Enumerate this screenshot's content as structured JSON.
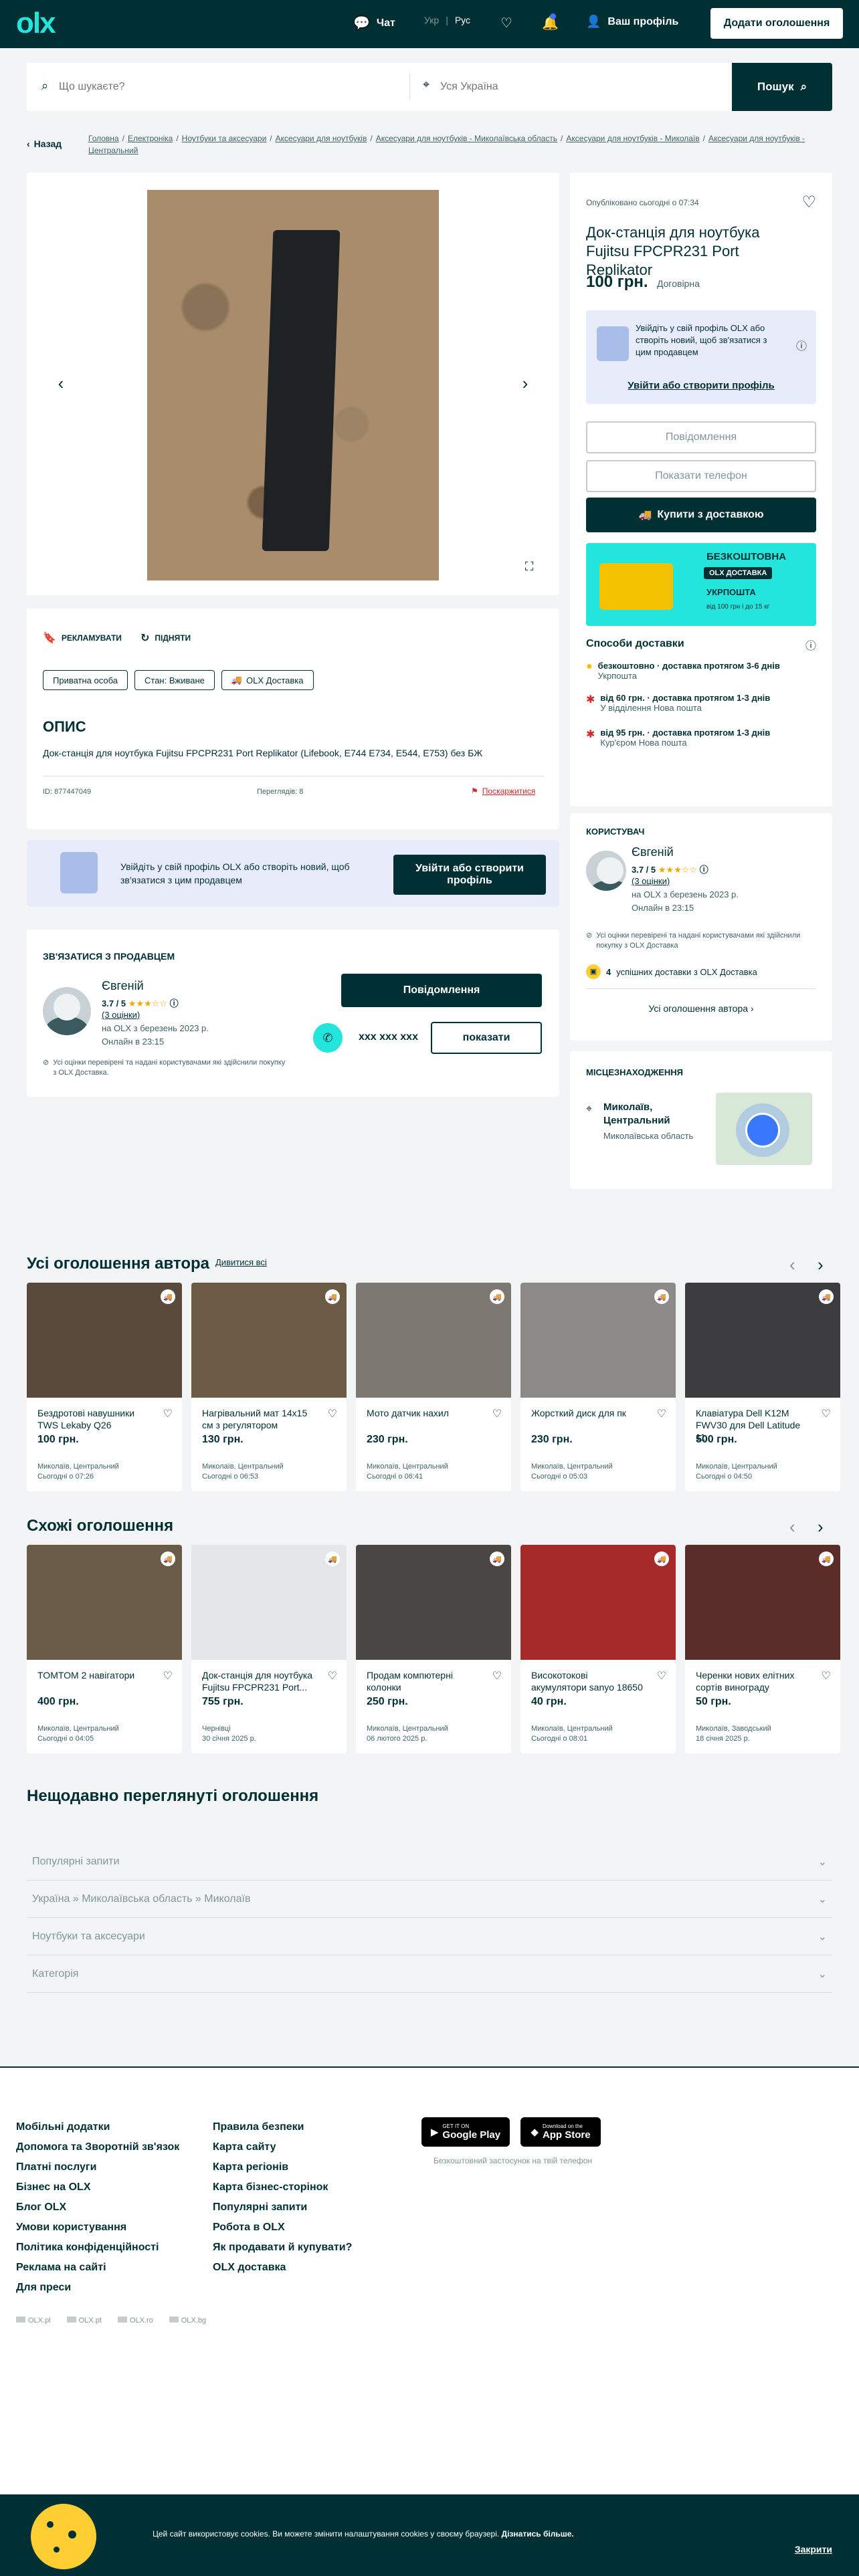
{
  "header": {
    "logo": "olx",
    "chat": "Чат",
    "lang_ukr": "Укр",
    "lang_sep": "|",
    "lang_rus": "Рус",
    "profile": "Ваш профіль",
    "post_ad": "Додати оголошення"
  },
  "search": {
    "query_placeholder": "Що шукаєте?",
    "location_placeholder": "Уся Україна",
    "button": "Пошук"
  },
  "breadcrumbs": {
    "back": "Назад",
    "items": [
      "Головна",
      "Електроніка",
      "Ноутбуки та аксесуари",
      "Аксесуари для ноутбуків",
      "Аксесуари для ноутбуків - Миколаївська область",
      "Аксесуари для ноутбуків - Миколаїв",
      "Аксесуари для ноутбуків - Центральний"
    ],
    "sep": "/"
  },
  "ad": {
    "published": "Опубліковано сьогодні о 07:34",
    "title": "Док-станція для ноутбука Fujitsu FPCPR231 Port Replikator",
    "price": "100 грн.",
    "negotiable": "Договірна",
    "promote": "РЕКЛАМУВАТИ",
    "raise": "ПІДНЯТИ",
    "tags": [
      "Приватна особа",
      "Стан: Вживане",
      "OLX Доставка"
    ],
    "description_heading": "ОПИС",
    "description": "Док-станція для ноутбука Fujitsu FPCPR231 Port Replikator (Lifebook, E744 E734, E544, E753) без БЖ",
    "id": "ID: 877447049",
    "views": "Переглядів: 8",
    "report": "Поскаржитися"
  },
  "side": {
    "login_text": "Увійдіть у свій профіль OLX або створіть новий, щоб зв'язатися з цим продавцем",
    "login_link": "Увійти або створити профіль",
    "message_btn": "Повідомлення",
    "phone_btn": "Показати телефон",
    "buy_btn": "Купити з доставкою",
    "promo_free": "БЕЗКОШТОВНА",
    "promo_olx": "OLX ДОСТАВКА",
    "promo_ukr": "УКРПОШТА",
    "promo_note": "від 100 грн і до 15 кг",
    "delivery_title": "Способи доставки",
    "delivery": [
      {
        "main": "безкоштовно · доставка протягом 3-6 днів",
        "sub": "Укрпошта"
      },
      {
        "main": "від 60 грн. · доставка протягом 1-3 днів",
        "sub": "У відділення Нова пошта"
      },
      {
        "main": "від 95 грн. · доставка протягом 1-3 днів",
        "sub": "Кур'єром Нова пошта"
      }
    ]
  },
  "user": {
    "heading": "КОРИСТУВАЧ",
    "name": "Євгеній",
    "rating": "3.7 / 5",
    "stars": "★★★☆☆",
    "reviews": "(3 оцінки)",
    "since": "на OLX з березень 2023 р.",
    "online": "Онлайн в 23:15",
    "note": "Усі оцінки перевірені та надані користувачами які здійснили покупку з OLX Доставка",
    "deliveries_count": "4",
    "deliveries": "успішних доставки з OLX Доставка",
    "all_ads": "Усі оголошення автора"
  },
  "location": {
    "heading": "МІСЦЕЗНАХОДЖЕННЯ",
    "city": "Миколаїв, Центральний",
    "region": "Миколаївська область"
  },
  "login_banner": {
    "text": "Увійдіть у свій профіль OLX або створіть новий, щоб зв'язатися з цим продавцем",
    "button": "Увійти або створити профіль"
  },
  "contact": {
    "heading": "ЗВ'ЯЗАТИСЯ З ПРОДАВЦЕМ",
    "name": "Євгеній",
    "rating": "3.7 / 5",
    "stars": "★★★☆☆",
    "reviews": "(3 оцінки)",
    "since": "на OLX з березень 2023 р.",
    "online": "Онлайн в 23:15",
    "note": "Усі оцінки перевірені та надані користувачами які здійснили покупку з OLX Доставка.",
    "message_btn": "Повідомлення",
    "phone_masked": "xxx xxx xxx",
    "show_btn": "показати"
  },
  "author_ads": {
    "heading": "Усі оголошення автора",
    "see_all": "Дивитися всі",
    "items": [
      {
        "title": "Бездротові навушники TWS Lekaby Q26",
        "price": "100 грн.",
        "loc": "Миколаїв, Центральний",
        "date": "Сьогодні о 07:26",
        "color": "#5a4a3c"
      },
      {
        "title": "Нагрівальний мат 14х15 см з регулятором",
        "price": "130 грн.",
        "loc": "Миколаїв, Центральний",
        "date": "Сьогодні о 06:53",
        "color": "#6b5a44"
      },
      {
        "title": "Мото датчик нахил",
        "price": "230 грн.",
        "loc": "Миколаїв, Центральний",
        "date": "Сьогодні о 06:41",
        "color": "#7d7872"
      },
      {
        "title": "Жорсткий диск для пк",
        "price": "230 грн.",
        "loc": "Миколаїв, Центральний",
        "date": "Сьогодні о 05:03",
        "color": "#8c8a86"
      },
      {
        "title": "Клавіатура Dell K12M FWV30 для Dell Latitude 11...",
        "price": "500 грн.",
        "loc": "Миколаїв, Центральний",
        "date": "Сьогодні о 04:50",
        "color": "#3c3c3e"
      }
    ]
  },
  "similar": {
    "heading": "Схожі оголошення",
    "items": [
      {
        "title": "TOMTOM 2 навігатори",
        "price": "400 грн.",
        "loc": "Миколаїв, Центральний",
        "date": "Сьогодні о 04:05",
        "color": "#6a5a48"
      },
      {
        "title": "Док-станція для ноутбука Fujitsu FPCPR231 Port...",
        "price": "755 грн.",
        "loc": "Чернівці",
        "date": "30 січня 2025 р.",
        "color": "#e4e6e8"
      },
      {
        "title": "Продам компютерні колонки",
        "price": "250 грн.",
        "loc": "Миколаїв, Центральний",
        "date": "06 лютого 2025 р.",
        "color": "#4a4644"
      },
      {
        "title": "Високотокові акумулятори sanyo 18650",
        "price": "40 грн.",
        "loc": "Миколаїв, Центральний",
        "date": "Сьогодні о 08:01",
        "color": "#a62a2a"
      },
      {
        "title": "Черенки нових елітних сортів винограду",
        "price": "50 грн.",
        "loc": "Миколаїв, Заводський",
        "date": "18 січня 2025 р.",
        "color": "#5a2c2a"
      }
    ]
  },
  "recent": {
    "heading": "Нещодавно переглянуті оголошення"
  },
  "accordion": [
    "Популярні запити",
    "Україна » Миколаївська область » Миколаїв",
    "Ноутбуки та аксесуари",
    "Категорія"
  ],
  "footer": {
    "col1": [
      "Мобільні додатки",
      "Допомога та Зворотній зв'язок",
      "Платні послуги",
      "Бізнес на OLX",
      "Блог OLX",
      "Умови користування",
      "Політика конфіденційності",
      "Реклама на сайті",
      "Для преси"
    ],
    "col2": [
      "Правила безпеки",
      "Карта сайту",
      "Карта регіонів",
      "Карта бізнес-сторінок",
      "Популярні запити",
      "Робота в OLX",
      "Як продавати й купувати?",
      "OLX доставка"
    ],
    "google": "Google Play",
    "google_small": "GET IT ON",
    "apple": "App Store",
    "apple_small": "Download on the",
    "app_note": "Безкоштовний застосунок на твій телефон",
    "sites": [
      "OLX.pl",
      "OLX.pt",
      "OLX.ro",
      "OLX.bg"
    ]
  },
  "cookie": {
    "text": "Цей сайт використовує cookies. Ви можете змінити налаштування cookies у своєму браузері.",
    "link": "Дізнатись більше.",
    "close": "Закрити"
  }
}
